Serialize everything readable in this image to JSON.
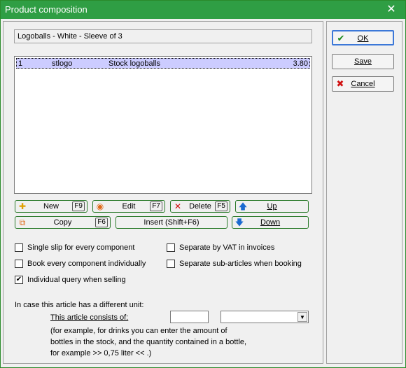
{
  "window": {
    "title": "Product composition",
    "close_icon": "close-icon"
  },
  "article": {
    "description": "Logoballs - White - Sleeve of 3"
  },
  "components": [
    {
      "qty": "1",
      "code": "stlogo",
      "name": "Stock logoballs",
      "price": "3.80"
    }
  ],
  "actions": {
    "new": {
      "label": "New",
      "key": "F9",
      "icon": "plus-icon"
    },
    "edit": {
      "label": "Edit",
      "key": "F7",
      "icon": "edit-icon"
    },
    "delete": {
      "label": "Delete",
      "key": "F5",
      "icon": "delete-icon"
    },
    "up": {
      "label": "Up",
      "icon": "arrow-up-icon"
    },
    "copy": {
      "label": "Copy",
      "key": "F6",
      "icon": "copy-icon"
    },
    "insert": {
      "label": "Insert (Shift+F6)"
    },
    "down": {
      "label": "Down",
      "icon": "arrow-down-icon"
    }
  },
  "dialog_buttons": {
    "ok": "OK",
    "save": "Save",
    "cancel": "Cancel"
  },
  "options": {
    "single_slip": {
      "label": "Single slip for every component",
      "checked": false
    },
    "separate_vat": {
      "label": "Separate by VAT in invoices",
      "checked": false
    },
    "book_each": {
      "label": "Book every component individually",
      "checked": false
    },
    "separate_sub": {
      "label": "Separate sub-articles when booking",
      "checked": false
    },
    "individual_query": {
      "label": "Individual query when selling",
      "checked": true
    }
  },
  "unit": {
    "intro": "In case this article has a different unit:",
    "consists_label": "This article consists of:",
    "qty_value": "",
    "unit_value": "",
    "hint_1": "(for example, for drinks you can enter the amount of",
    "hint_2": "bottles in the stock, and the quantity contained in a bottle,",
    "hint_3": "for example >> 0,75 liter << .)"
  },
  "colors": {
    "titlebar": "#2f9e44",
    "selected_row": "#ccccff",
    "button_border": "#2a7a2a"
  }
}
